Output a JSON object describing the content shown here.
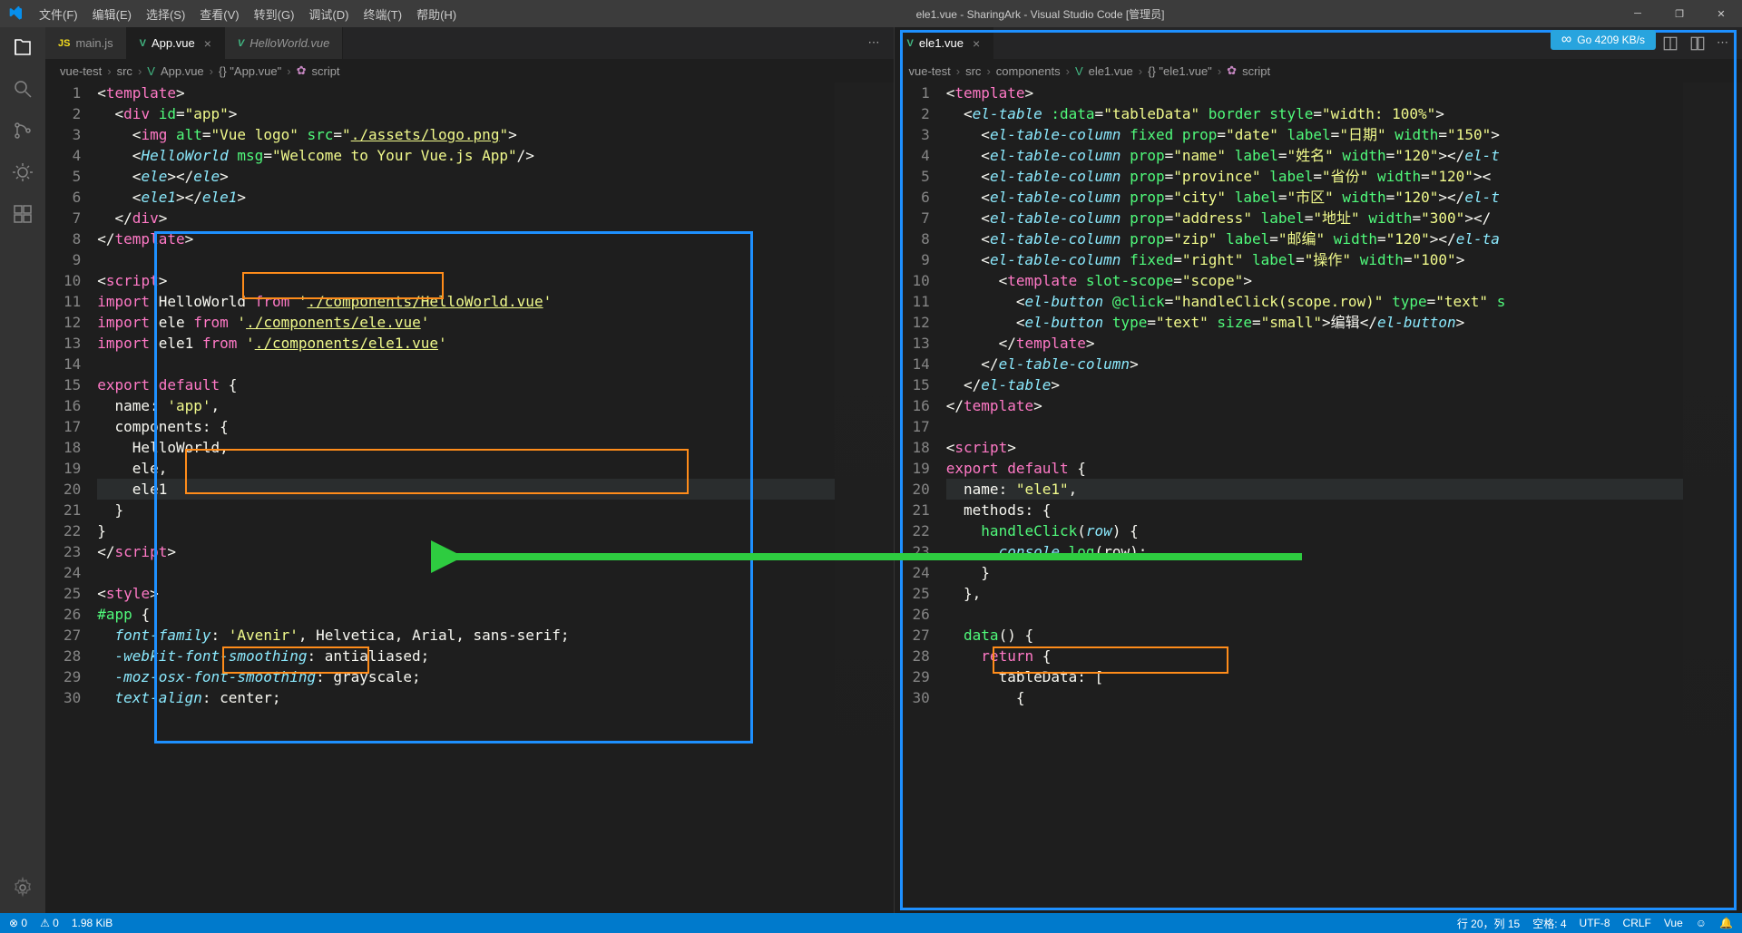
{
  "titlebar": {
    "menu": [
      "文件(F)",
      "编辑(E)",
      "选择(S)",
      "查看(V)",
      "转到(G)",
      "调试(D)",
      "终端(T)",
      "帮助(H)"
    ],
    "title": "ele1.vue - SharingArk - Visual Studio Code [管理员]"
  },
  "go_badge": "Go 4209 KB/s",
  "pane_left": {
    "tabs": [
      {
        "icon": "js",
        "label": "main.js",
        "active": false,
        "dirty": false
      },
      {
        "icon": "vue",
        "label": "App.vue",
        "active": true,
        "dirty": false,
        "close": true
      },
      {
        "icon": "vue",
        "label": "HelloWorld.vue",
        "active": false,
        "italic": true
      }
    ],
    "breadcrumb": [
      "vue-test",
      "src",
      "App.vue",
      "{} \"App.vue\"",
      "script"
    ],
    "lines": [
      {
        "n": 1,
        "html": "<span class='punct'>&lt;</span><span class='tag'>template</span><span class='punct'>&gt;</span>"
      },
      {
        "n": 2,
        "html": "  <span class='punct'>&lt;</span><span class='tag'>div</span> <span class='attr'>id</span><span class='punct'>=</span><span class='str'>\"app\"</span><span class='punct'>&gt;</span>"
      },
      {
        "n": 3,
        "html": "    <span class='punct'>&lt;</span><span class='tag'>img</span> <span class='attr'>alt</span><span class='punct'>=</span><span class='str'>\"Vue logo\"</span> <span class='attr'>src</span><span class='punct'>=</span><span class='str'>\"<u>./assets/logo.png</u>\"</span><span class='punct'>&gt;</span>"
      },
      {
        "n": 4,
        "html": "    <span class='punct'>&lt;</span><span class='comp'>HelloWorld</span> <span class='attr'>msg</span><span class='punct'>=</span><span class='str'>\"Welcome to Your Vue.js App\"</span><span class='punct'>/&gt;</span>"
      },
      {
        "n": 5,
        "html": "    <span class='punct'>&lt;</span><span class='comp'>ele</span><span class='punct'>&gt;&lt;/</span><span class='comp'>ele</span><span class='punct'>&gt;</span>"
      },
      {
        "n": 6,
        "html": "    <span class='punct'>&lt;</span><span class='comp'>ele1</span><span class='punct'>&gt;&lt;/</span><span class='comp'>ele1</span><span class='punct'>&gt;</span>"
      },
      {
        "n": 7,
        "html": "  <span class='punct'>&lt;/</span><span class='tag'>div</span><span class='punct'>&gt;</span>"
      },
      {
        "n": 8,
        "html": "<span class='punct'>&lt;/</span><span class='tag'>template</span><span class='punct'>&gt;</span>"
      },
      {
        "n": 9,
        "html": ""
      },
      {
        "n": 10,
        "html": "<span class='punct'>&lt;</span><span class='tag'>script</span><span class='punct'>&gt;</span>"
      },
      {
        "n": 11,
        "html": "<span class='kw'>import</span> <span class='plain'>HelloWorld</span> <span class='kw'>from</span> <span class='str'>'<u>./components/HelloWorld.vue</u>'</span>"
      },
      {
        "n": 12,
        "html": "<span class='kw'>import</span> <span class='plain'>ele</span> <span class='kw'>from</span> <span class='str'>'<u>./components/ele.vue</u>'</span>"
      },
      {
        "n": 13,
        "html": "<span class='kw'>import</span> <span class='plain'>ele1</span> <span class='kw'>from</span> <span class='str'>'<u>./components/ele1.vue</u>'</span>"
      },
      {
        "n": 14,
        "html": ""
      },
      {
        "n": 15,
        "html": "<span class='kw'>export</span> <span class='kw'>default</span> <span class='punct'>{</span>"
      },
      {
        "n": 16,
        "html": "  <span class='plain'>name:</span> <span class='str'>'app'</span><span class='punct'>,</span>"
      },
      {
        "n": 17,
        "html": "  <span class='plain'>components:</span> <span class='punct'>{</span>"
      },
      {
        "n": 18,
        "html": "    <span class='plain'>HelloWorld,</span>"
      },
      {
        "n": 19,
        "html": "    <span class='plain'>ele,</span>"
      },
      {
        "n": 20,
        "html": "    <span class='plain'>ele1</span>",
        "hl": true
      },
      {
        "n": 21,
        "html": "  <span class='punct'>}</span>"
      },
      {
        "n": 22,
        "html": "<span class='punct'>}</span>"
      },
      {
        "n": 23,
        "html": "<span class='punct'>&lt;/</span><span class='tag'>script</span><span class='punct'>&gt;</span>"
      },
      {
        "n": 24,
        "html": ""
      },
      {
        "n": 25,
        "html": "<span class='punct'>&lt;</span><span class='tag'>style</span><span class='punct'>&gt;</span>"
      },
      {
        "n": 26,
        "html": "<span class='prop'>#app</span> <span class='punct'>{</span>"
      },
      {
        "n": 27,
        "html": "  <span class='comp'>font-family</span><span class='punct'>:</span> <span class='str'>'Avenir'</span><span class='punct'>, Helvetica, Arial, sans-serif;</span>"
      },
      {
        "n": 28,
        "html": "  <span class='comp'>-webkit-font-smoothing</span><span class='punct'>: antialiased;</span>"
      },
      {
        "n": 29,
        "html": "  <span class='comp'>-moz-osx-font-smoothing</span><span class='punct'>: grayscale;</span>"
      },
      {
        "n": 30,
        "html": "  <span class='comp'>text-align</span><span class='punct'>: center;</span>"
      }
    ]
  },
  "pane_right": {
    "tabs": [
      {
        "icon": "vue",
        "label": "ele1.vue",
        "active": true,
        "close": true
      }
    ],
    "breadcrumb": [
      "vue-test",
      "src",
      "components",
      "ele1.vue",
      "{} \"ele1.vue\"",
      "script"
    ],
    "lines": [
      {
        "n": 1,
        "html": "<span class='punct'>&lt;</span><span class='tag'>template</span><span class='punct'>&gt;</span>"
      },
      {
        "n": 2,
        "html": "  <span class='punct'>&lt;</span><span class='comp'>el-table</span> <span class='attr'>:data</span><span class='punct'>=</span><span class='str'>\"tableData\"</span> <span class='attr'>border</span> <span class='attr'>style</span><span class='punct'>=</span><span class='str'>\"width: 100%\"</span><span class='punct'>&gt;</span>"
      },
      {
        "n": 3,
        "html": "    <span class='punct'>&lt;</span><span class='comp'>el-table-column</span> <span class='attr'>fixed</span> <span class='attr'>prop</span><span class='punct'>=</span><span class='str'>\"date\"</span> <span class='attr'>label</span><span class='punct'>=</span><span class='str'>\"日期\"</span> <span class='attr'>width</span><span class='punct'>=</span><span class='str'>\"150\"</span><span class='punct'>&gt;</span>"
      },
      {
        "n": 4,
        "html": "    <span class='punct'>&lt;</span><span class='comp'>el-table-column</span> <span class='attr'>prop</span><span class='punct'>=</span><span class='str'>\"name\"</span> <span class='attr'>label</span><span class='punct'>=</span><span class='str'>\"姓名\"</span> <span class='attr'>width</span><span class='punct'>=</span><span class='str'>\"120\"</span><span class='punct'>&gt;&lt;/</span><span class='comp'>el-t</span>"
      },
      {
        "n": 5,
        "html": "    <span class='punct'>&lt;</span><span class='comp'>el-table-column</span> <span class='attr'>prop</span><span class='punct'>=</span><span class='str'>\"province\"</span> <span class='attr'>label</span><span class='punct'>=</span><span class='str'>\"省份\"</span> <span class='attr'>width</span><span class='punct'>=</span><span class='str'>\"120\"</span><span class='punct'>&gt;&lt;</span>"
      },
      {
        "n": 6,
        "html": "    <span class='punct'>&lt;</span><span class='comp'>el-table-column</span> <span class='attr'>prop</span><span class='punct'>=</span><span class='str'>\"city\"</span> <span class='attr'>label</span><span class='punct'>=</span><span class='str'>\"市区\"</span> <span class='attr'>width</span><span class='punct'>=</span><span class='str'>\"120\"</span><span class='punct'>&gt;&lt;/</span><span class='comp'>el-t</span>"
      },
      {
        "n": 7,
        "html": "    <span class='punct'>&lt;</span><span class='comp'>el-table-column</span> <span class='attr'>prop</span><span class='punct'>=</span><span class='str'>\"address\"</span> <span class='attr'>label</span><span class='punct'>=</span><span class='str'>\"地址\"</span> <span class='attr'>width</span><span class='punct'>=</span><span class='str'>\"300\"</span><span class='punct'>&gt;&lt;/</span>"
      },
      {
        "n": 8,
        "html": "    <span class='punct'>&lt;</span><span class='comp'>el-table-column</span> <span class='attr'>prop</span><span class='punct'>=</span><span class='str'>\"zip\"</span> <span class='attr'>label</span><span class='punct'>=</span><span class='str'>\"邮编\"</span> <span class='attr'>width</span><span class='punct'>=</span><span class='str'>\"120\"</span><span class='punct'>&gt;&lt;/</span><span class='comp'>el-ta</span>"
      },
      {
        "n": 9,
        "html": "    <span class='punct'>&lt;</span><span class='comp'>el-table-column</span> <span class='attr'>fixed</span><span class='punct'>=</span><span class='str'>\"right\"</span> <span class='attr'>label</span><span class='punct'>=</span><span class='str'>\"操作\"</span> <span class='attr'>width</span><span class='punct'>=</span><span class='str'>\"100\"</span><span class='punct'>&gt;</span>"
      },
      {
        "n": 10,
        "html": "      <span class='punct'>&lt;</span><span class='tag'>template</span> <span class='attr'>slot-scope</span><span class='punct'>=</span><span class='str'>\"scope\"</span><span class='punct'>&gt;</span>"
      },
      {
        "n": 11,
        "html": "        <span class='punct'>&lt;</span><span class='comp'>el-button</span> <span class='attr'>@click</span><span class='punct'>=</span><span class='str'>\"handleClick(scope.row)\"</span> <span class='attr'>type</span><span class='punct'>=</span><span class='str'>\"text\"</span> <span class='attr'>s</span>"
      },
      {
        "n": 12,
        "html": "        <span class='punct'>&lt;</span><span class='comp'>el-button</span> <span class='attr'>type</span><span class='punct'>=</span><span class='str'>\"text\"</span> <span class='attr'>size</span><span class='punct'>=</span><span class='str'>\"small\"</span><span class='punct'>&gt;</span><span class='plain'>编辑</span><span class='punct'>&lt;/</span><span class='comp'>el-button</span><span class='punct'>&gt;</span>"
      },
      {
        "n": 13,
        "html": "      <span class='punct'>&lt;/</span><span class='tag'>template</span><span class='punct'>&gt;</span>"
      },
      {
        "n": 14,
        "html": "    <span class='punct'>&lt;/</span><span class='comp'>el-table-column</span><span class='punct'>&gt;</span>"
      },
      {
        "n": 15,
        "html": "  <span class='punct'>&lt;/</span><span class='comp'>el-table</span><span class='punct'>&gt;</span>"
      },
      {
        "n": 16,
        "html": "<span class='punct'>&lt;/</span><span class='tag'>template</span><span class='punct'>&gt;</span>"
      },
      {
        "n": 17,
        "html": ""
      },
      {
        "n": 18,
        "html": "<span class='punct'>&lt;</span><span class='tag'>script</span><span class='punct'>&gt;</span>"
      },
      {
        "n": 19,
        "html": "<span class='kw'>export</span> <span class='kw'>default</span> <span class='punct'>{</span>"
      },
      {
        "n": 20,
        "html": "  <span class='plain'>name:</span> <span class='str'>\"ele1\"</span><span class='punct'>,</span>",
        "hl": true
      },
      {
        "n": 21,
        "html": "  <span class='plain'>methods:</span> <span class='punct'>{</span>"
      },
      {
        "n": 22,
        "html": "    <span class='fn'>handleClick</span><span class='punct'>(</span><span class='comp'>row</span><span class='punct'>) {</span>"
      },
      {
        "n": 23,
        "html": "      <span class='comp'>console</span><span class='punct'>.</span><span class='fn'>log</span><span class='punct'>(</span><span class='plain'>row</span><span class='punct'>);</span>"
      },
      {
        "n": 24,
        "html": "    <span class='punct'>}</span>"
      },
      {
        "n": 25,
        "html": "  <span class='punct'>},</span>"
      },
      {
        "n": 26,
        "html": ""
      },
      {
        "n": 27,
        "html": "  <span class='fn'>data</span><span class='punct'>() {</span>"
      },
      {
        "n": 28,
        "html": "    <span class='kw'>return</span> <span class='punct'>{</span>"
      },
      {
        "n": 29,
        "html": "      <span class='plain'>tableData:</span> <span class='punct'>[</span>"
      },
      {
        "n": 30,
        "html": "        <span class='punct'>{</span>"
      }
    ]
  },
  "statusbar": {
    "left": [
      "⊗ 0",
      "⚠ 0",
      "1.98 KiB"
    ],
    "right": [
      "行 20，列 15",
      "空格: 4",
      "UTF-8",
      "CRLF",
      "Vue",
      "☺",
      "🔔"
    ]
  },
  "annotations": {
    "orange_boxes_desc": "highlights: <ele1></ele1>, import ele1 line, ele1 component, name: \"ele1\"",
    "blue_boxes_desc": "left pane upper block, right entire editor",
    "arrow_desc": "green arrow pointing from right editor to left components section"
  }
}
